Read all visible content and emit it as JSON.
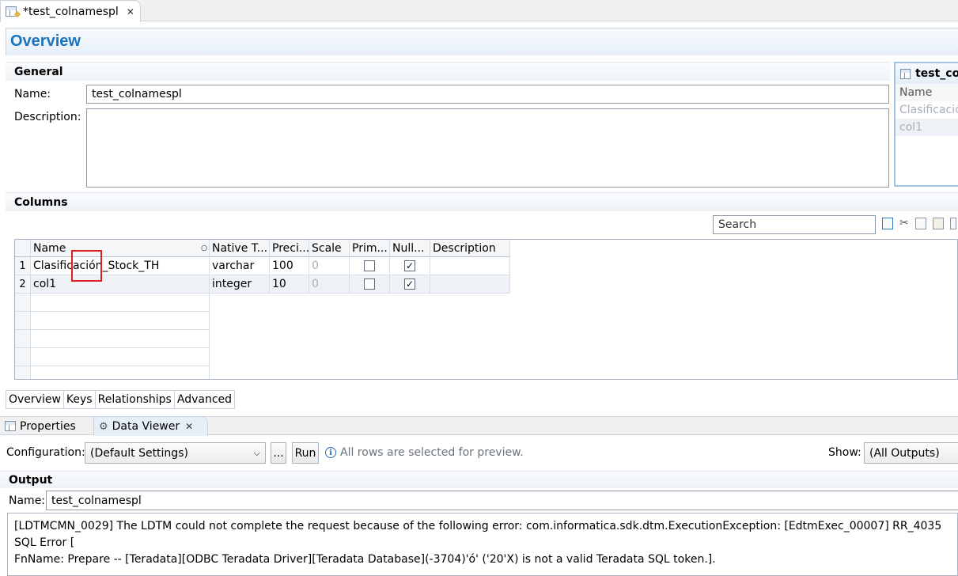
{
  "editor": {
    "tab_title": "*test_colnamespl",
    "view_title": "Overview"
  },
  "general": {
    "heading": "General",
    "name_label": "Name:",
    "name_value": "test_colnamespl",
    "description_label": "Description:",
    "description_value": ""
  },
  "preview": {
    "title": "test_col",
    "header": "Name",
    "rows": [
      "Clasificació",
      "col1"
    ]
  },
  "columns": {
    "heading": "Columns",
    "search_placeholder": "Search",
    "headers": [
      "Name",
      "Native T...",
      "Preci...",
      "Scale",
      "Prim...",
      "Null...",
      "Description"
    ],
    "rows": [
      {
        "num": "1",
        "name": "Clasificación_Stock_TH",
        "native_type": "varchar",
        "precision": "100",
        "scale": "0",
        "primary": false,
        "nullable": true,
        "description": ""
      },
      {
        "num": "2",
        "name": "col1",
        "native_type": "integer",
        "precision": "10",
        "scale": "0",
        "primary": false,
        "nullable": true,
        "description": ""
      }
    ]
  },
  "editor_tabs": [
    "Overview",
    "Keys",
    "Relationships",
    "Advanced"
  ],
  "views": {
    "properties": "Properties",
    "data_viewer": "Data Viewer"
  },
  "data_viewer": {
    "config_label": "Configuration:",
    "config_value": "(Default Settings)",
    "ellipsis": "...",
    "run": "Run",
    "info": "All rows are selected for preview.",
    "show_label": "Show:",
    "show_value": "(All Outputs)",
    "output_heading": "Output",
    "output_name_label": "Name:",
    "output_name_value": "test_colnamespl",
    "error_line1": "[LDTMCMN_0029] The LDTM could not complete the request because of the following error: com.informatica.sdk.dtm.ExecutionException: [EdtmExec_00007] RR_4035 SQL Error [",
    "error_line2": "FnName: Prepare -- [Teradata][ODBC Teradata Driver][Teradata Database](-3704)'ó' ('20'X) is not a valid Teradata SQL token.]."
  }
}
